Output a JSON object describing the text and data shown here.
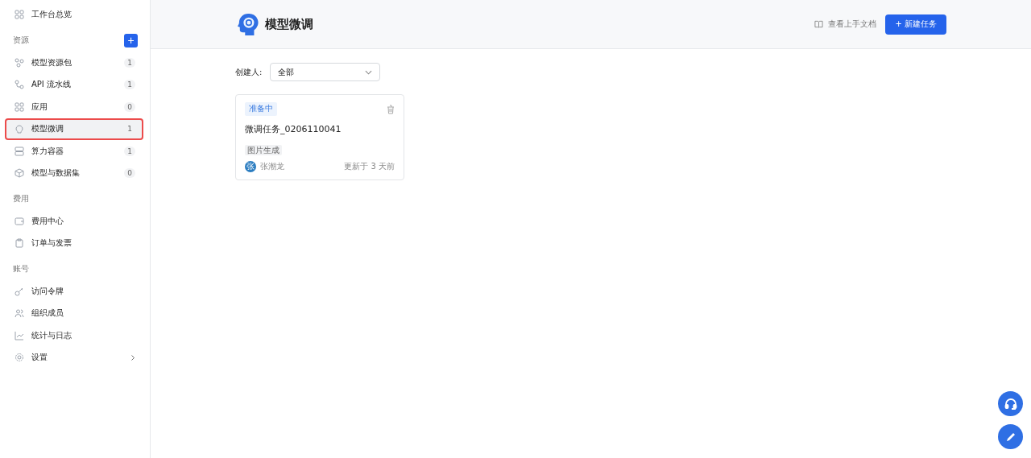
{
  "sidebar": {
    "top_item": {
      "label": "工作台总览",
      "selected": false
    },
    "sections": [
      {
        "title": "资源",
        "add_label": "+",
        "items": [
          {
            "label": "模型资源包",
            "count": "1",
            "selected": false,
            "chevron": false
          },
          {
            "label": "API 流水线",
            "count": "1",
            "selected": false,
            "chevron": false
          },
          {
            "label": "应用",
            "count": "0",
            "selected": false,
            "chevron": false
          },
          {
            "label": "模型微调",
            "count": "1",
            "selected": true,
            "chevron": false
          },
          {
            "label": "算力容器",
            "count": "1",
            "selected": false,
            "chevron": false
          },
          {
            "label": "模型与数据集",
            "count": "0",
            "selected": false,
            "chevron": false
          }
        ]
      },
      {
        "title": "费用",
        "items": [
          {
            "label": "费用中心",
            "selected": false,
            "chevron": false
          },
          {
            "label": "订单与发票",
            "selected": false,
            "chevron": false
          }
        ]
      },
      {
        "title": "账号",
        "items": [
          {
            "label": "访问令牌",
            "selected": false,
            "chevron": false
          },
          {
            "label": "组织成员",
            "selected": false,
            "chevron": false
          },
          {
            "label": "统计与日志",
            "selected": false,
            "chevron": false
          },
          {
            "label": "设置",
            "selected": false,
            "chevron": true
          }
        ]
      }
    ]
  },
  "header": {
    "title": "模型微调",
    "docs_link": "查看上手文档",
    "new_button": "新建任务",
    "new_button_icon": "+"
  },
  "filter": {
    "label": "创建人:",
    "value": "全部"
  },
  "cards": [
    {
      "status": "准备中",
      "name": "微调任务_0206110041",
      "tag": "图片生成",
      "owner_initial": "张",
      "owner": "张潮龙",
      "updated": "更新于 3 天前"
    }
  ]
}
